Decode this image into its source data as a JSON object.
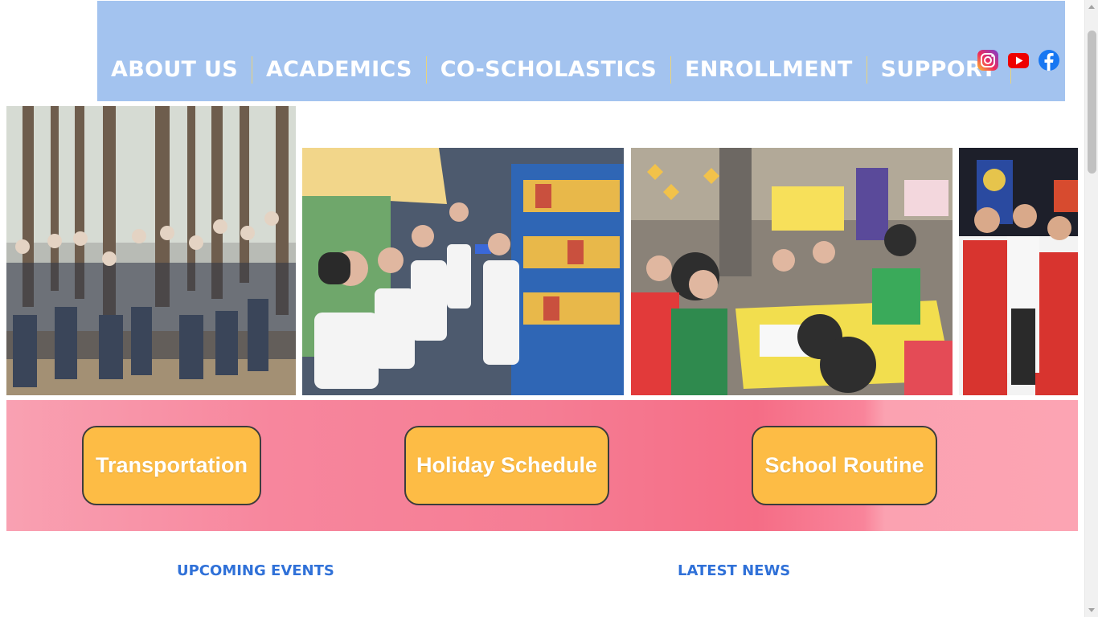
{
  "nav": {
    "items": [
      "ABOUT US",
      "ACADEMICS",
      "CO-SCHOLASTICS",
      "ENROLLMENT",
      "SUPPORT"
    ],
    "social": [
      "instagram-icon",
      "youtube-icon",
      "facebook-icon"
    ],
    "bg_color": "#a3c3ef"
  },
  "photos": [
    "group-photo-forest",
    "students-in-library-bus",
    "students-science-activity",
    "teachers-at-event"
  ],
  "quick_links": {
    "transportation": "Transportation",
    "holiday_schedule": "Holiday Schedule",
    "school_routine": "School Routine"
  },
  "sections": {
    "upcoming_events": "UPCOMING EVENTS",
    "latest_news": "LATEST NEWS"
  },
  "colors": {
    "button": "#fdbc45",
    "heading": "#3071d8",
    "banner": "#f57d94"
  }
}
